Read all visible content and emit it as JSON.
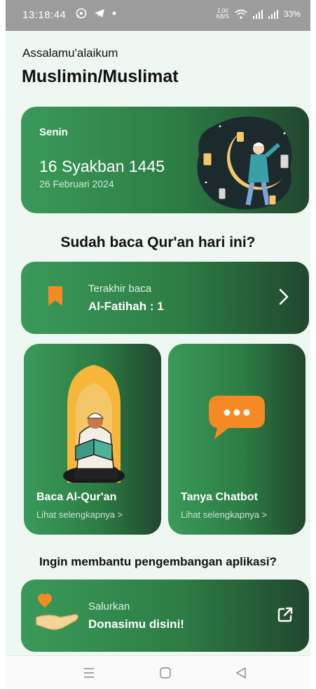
{
  "status_bar": {
    "time": "13:18:44",
    "speed_value": "2,00",
    "speed_unit": "KB/S",
    "battery": "33%"
  },
  "header": {
    "greeting": "Assalamu'alaikum",
    "username": "Muslimin/Muslimat"
  },
  "date_card": {
    "day": "Senin",
    "hijri_date": "16 Syakban 1445",
    "gregorian_date": "26 Februari 2024"
  },
  "prompt_title": "Sudah baca Qur'an hari ini?",
  "last_read": {
    "label": "Terakhir baca",
    "value": "Al-Fatihah : 1"
  },
  "tiles": [
    {
      "title": "Baca Al-Qur'an",
      "subtitle": "Lihat selengkapnya >"
    },
    {
      "title": "Tanya Chatbot",
      "subtitle": "Lihat selengkapnya >"
    }
  ],
  "support_title": "Ingin membantu pengembangan aplikasi?",
  "donate": {
    "label": "Salurkan",
    "value": "Donasimu disini!"
  },
  "colors": {
    "accent_green": "#2c7c44",
    "dark_green": "#21472e",
    "orange": "#f58a25",
    "background": "#eef7f1"
  },
  "icons": {
    "bookmark": "bookmark-icon",
    "chevron": "chevron-right-icon",
    "chat": "chat-bubble-icon",
    "external": "external-link-icon"
  }
}
